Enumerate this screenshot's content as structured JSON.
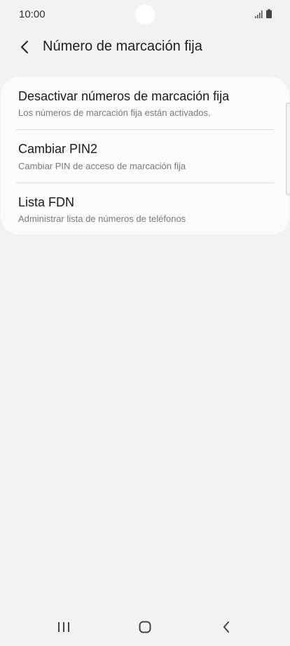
{
  "status_bar": {
    "time": "10:00"
  },
  "header": {
    "title": "Número de marcación fija",
    "back_icon": "chevron-left-icon"
  },
  "settings": {
    "items": [
      {
        "title": "Desactivar números de marcación fija",
        "subtitle": "Los números de marcación fija están activados."
      },
      {
        "title": "Cambiar PIN2",
        "subtitle": "Cambiar PIN de acceso de marcación fija"
      },
      {
        "title": "Lista FDN",
        "subtitle": "Administrar lista de números de teléfonos"
      }
    ]
  },
  "nav_bar": {
    "recents_icon": "recents-icon",
    "home_icon": "home-icon",
    "back_icon": "back-icon"
  },
  "colors": {
    "background": "#f2f2f2",
    "card": "#fbfbfb",
    "subtitle": "#7a7a7a",
    "divider": "#dddddd"
  }
}
